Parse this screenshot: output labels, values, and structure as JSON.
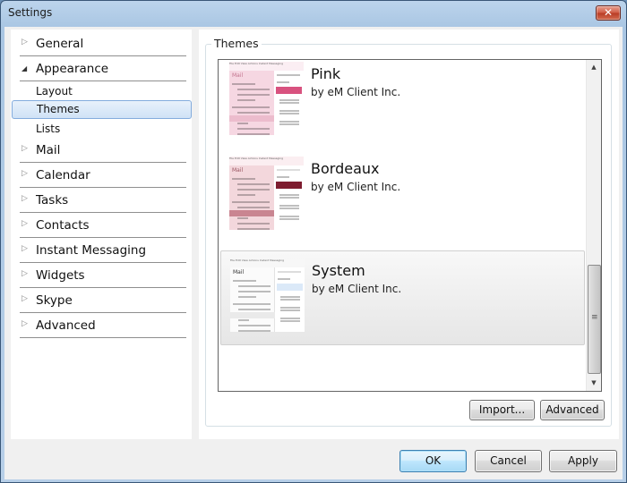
{
  "window": {
    "title": "Settings",
    "close_label": "✕"
  },
  "nav": {
    "groups": [
      {
        "label": "General",
        "expanded": false
      },
      {
        "label": "Appearance",
        "expanded": true,
        "children": [
          "Layout",
          "Themes",
          "Lists"
        ],
        "selected_child": "Themes"
      },
      {
        "label": "Mail",
        "expanded": false
      },
      {
        "label": "Calendar",
        "expanded": false
      },
      {
        "label": "Tasks",
        "expanded": false
      },
      {
        "label": "Contacts",
        "expanded": false
      },
      {
        "label": "Instant Messaging",
        "expanded": false
      },
      {
        "label": "Widgets",
        "expanded": false
      },
      {
        "label": "Skype",
        "expanded": false
      },
      {
        "label": "Advanced",
        "expanded": false
      }
    ],
    "collapsed_arrow": "▷",
    "expanded_arrow": "◢"
  },
  "themes": {
    "group_title": "Themes",
    "items": [
      {
        "name": "Pink",
        "author": "by eM Client Inc.",
        "selected": false,
        "thumb_label": "Mail"
      },
      {
        "name": "Bordeaux",
        "author": "by eM Client Inc.",
        "selected": false,
        "thumb_label": "Mail"
      },
      {
        "name": "System",
        "author": "by eM Client Inc.",
        "selected": true,
        "thumb_label": "Mail"
      }
    ],
    "thumb_menu": "File  Edit  View  Actions  Instant Messaging",
    "import_label": "Import...",
    "advanced_label": "Advanced"
  },
  "scrollbar": {
    "up_arrow": "▲",
    "down_arrow": "▼",
    "grip": "≡",
    "position_percent": 100
  },
  "footer": {
    "ok_label": "OK",
    "cancel_label": "Cancel",
    "apply_label": "Apply"
  },
  "colors": {
    "selection_border": "#84acdd",
    "pink_accent": "#d8527f",
    "bordeaux_accent": "#7e1c2f"
  }
}
